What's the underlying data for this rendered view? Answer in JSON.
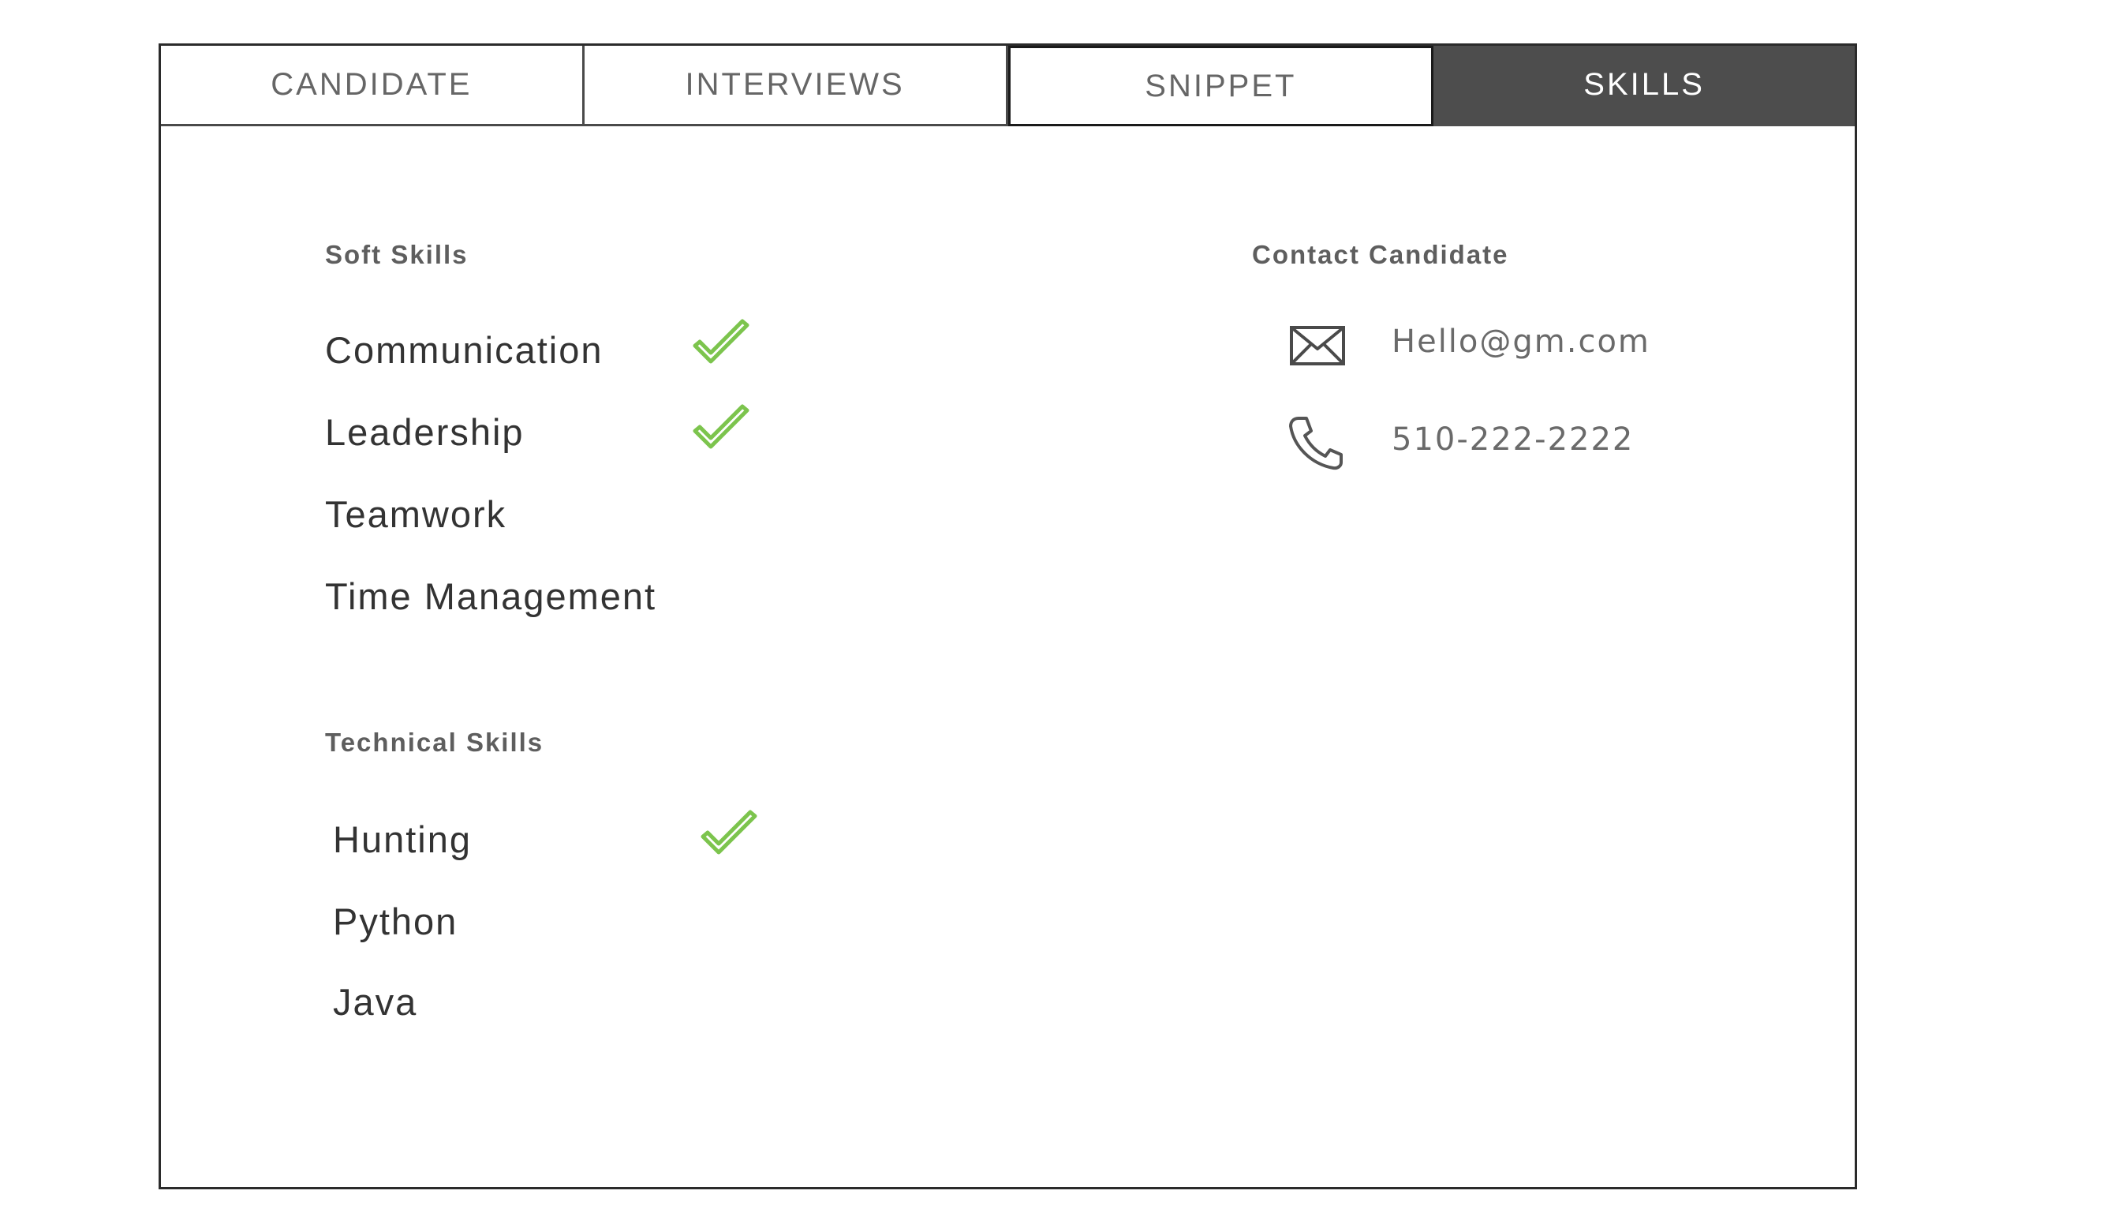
{
  "tabs": [
    {
      "label": "CANDIDATE",
      "active": false
    },
    {
      "label": "INTERVIEWS",
      "active": false
    },
    {
      "label": "SNIPPET",
      "active": false
    },
    {
      "label": "SKILLS",
      "active": true
    }
  ],
  "soft_skills": {
    "heading": "Soft Skills",
    "items": [
      {
        "label": "Communication",
        "checked": true
      },
      {
        "label": "Leadership",
        "checked": true
      },
      {
        "label": "Teamwork",
        "checked": false
      },
      {
        "label": "Time Management",
        "checked": false
      }
    ]
  },
  "technical_skills": {
    "heading": "Technical Skills",
    "items": [
      {
        "label": "Hunting",
        "checked": true
      },
      {
        "label": "Python",
        "checked": false
      },
      {
        "label": "Java",
        "checked": false
      }
    ]
  },
  "contact": {
    "heading": "Contact Candidate",
    "email": "Hello@gm.com",
    "phone": "510-222-2222",
    "email_icon": "envelope-icon",
    "phone_icon": "phone-icon"
  },
  "colors": {
    "active_tab": "#4d4d4d",
    "check": "#7cc44d",
    "text": "#333333",
    "muted": "#666666"
  }
}
